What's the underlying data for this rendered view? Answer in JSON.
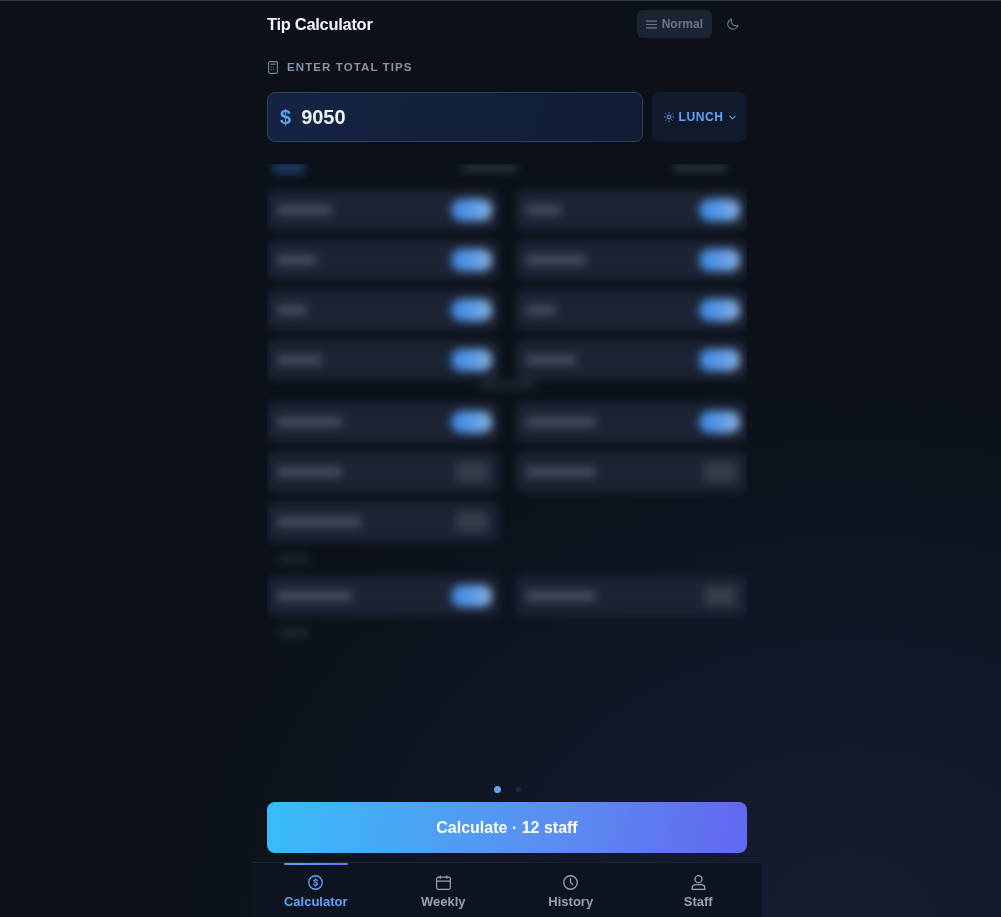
{
  "header": {
    "title": "Tip Calculator",
    "mode_button": "Normal"
  },
  "tips": {
    "label": "ENTER TOTAL TIPS",
    "currency": "$",
    "value": "9050",
    "shift": "LUNCH"
  },
  "staff_panel": {
    "blocks": [
      {
        "kind": "tabs",
        "tabs": [
          {
            "selected": true
          },
          {
            "selected": false
          },
          {
            "selected": false
          }
        ]
      },
      {
        "kind": "cards",
        "toggles": [
          {
            "on": true
          },
          {
            "on": true
          },
          {
            "on": true
          },
          {
            "on": true
          },
          {
            "on": true
          },
          {
            "on": true
          },
          {
            "on": true
          },
          {
            "on": true
          }
        ]
      },
      {
        "kind": "heading"
      },
      {
        "kind": "cards",
        "toggles": [
          {
            "on": true
          },
          {
            "on": true
          },
          {
            "on": false
          },
          {
            "on": false
          },
          {
            "on": false
          }
        ]
      },
      {
        "kind": "note"
      },
      {
        "kind": "cards",
        "toggles": [
          {
            "on": true
          },
          {
            "on": false
          }
        ]
      },
      {
        "kind": "note"
      }
    ]
  },
  "pager": [
    {
      "selected": true
    },
    {
      "selected": false
    }
  ],
  "calculate_button": "Calculate · 12 staff",
  "nav": [
    {
      "label": "Calculator",
      "selected": true
    },
    {
      "label": "Weekly",
      "selected": false
    },
    {
      "label": "History",
      "selected": false
    },
    {
      "label": "Staff",
      "selected": false
    }
  ]
}
